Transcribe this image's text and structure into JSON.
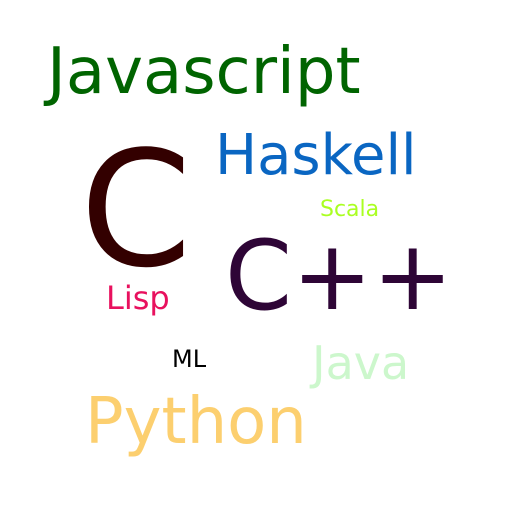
{
  "words": {
    "javascript": {
      "text": "Javascript",
      "color": "#006400"
    },
    "haskell": {
      "text": "Haskell",
      "color": "#0a66c2"
    },
    "c": {
      "text": "C",
      "color": "#330000"
    },
    "scala": {
      "text": "Scala",
      "color": "#aaff22"
    },
    "cpp": {
      "text": "C++",
      "color": "#2e0536"
    },
    "lisp": {
      "text": "Lisp",
      "color": "#e8115e"
    },
    "ml": {
      "text": "ML",
      "color": "#000000"
    },
    "java": {
      "text": "Java",
      "color": "#ccf7cc"
    },
    "python": {
      "text": "Python",
      "color": "#fccf6f"
    }
  }
}
